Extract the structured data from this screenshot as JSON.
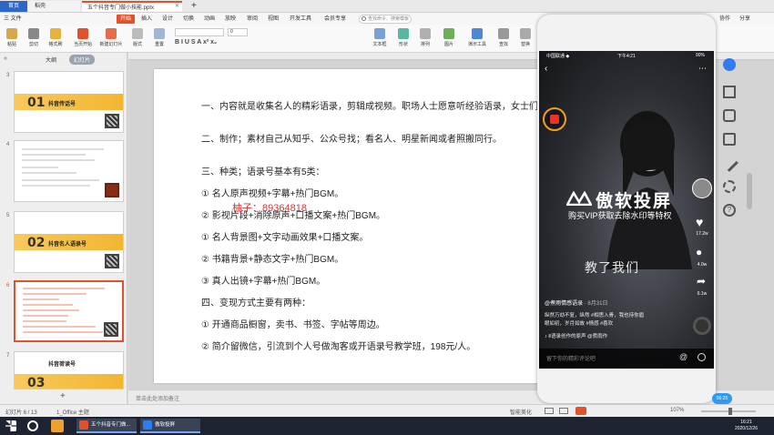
{
  "window": {
    "tabs": [
      {
        "label": "首页"
      },
      {
        "label": "稻壳"
      },
      {
        "label": "五个抖音专门做小技能.pptx"
      }
    ]
  },
  "menubar": {
    "items": [
      "三 文件",
      "开始",
      "插入",
      "设计",
      "切换",
      "动画",
      "放映",
      "审阅",
      "视图",
      "开发工具",
      "会员专享"
    ],
    "search_placeholder": "查找命令、搜索模板",
    "right": [
      "协作",
      "分享"
    ]
  },
  "ribbon": {
    "buttons": [
      "粘贴",
      "剪切",
      "格式刷",
      "当页开始",
      "新建幻灯片",
      "版式",
      "重置",
      "文本框",
      "形状",
      "排列",
      "图片",
      "演示工具",
      "查找",
      "替换"
    ],
    "format_glyphs": "B I U S A x² x₂",
    "font_name": "",
    "font_size": "0"
  },
  "leftpane": {
    "tab_outline": "大纲",
    "tab_slides": "幻灯片",
    "thumbs": [
      {
        "num": "3",
        "bignum": "01",
        "title": "抖音传话号",
        "style": "cover",
        "selected": false
      },
      {
        "num": "4",
        "bignum": "",
        "title": "",
        "style": "text",
        "selected": false
      },
      {
        "num": "5",
        "bignum": "02",
        "title": "抖音名人语录号",
        "style": "cover",
        "selected": false
      },
      {
        "num": "6",
        "bignum": "",
        "title": "",
        "style": "text-red",
        "selected": true
      },
      {
        "num": "7",
        "bignum": "03",
        "title": "抖音荷读号",
        "style": "cover",
        "selected": false
      }
    ]
  },
  "slide": {
    "lines": [
      "一、内容就是收集名人的精彩语录，剪辑成视频。职场人士愿意听经验语录，女士们",
      "二、制作；素材自己从知乎、公众号找；看名人、明星新闻或者照搬同行。",
      "三、种类；语录号基本有5类：",
      "① 名人原声视频+字幕+热门BGM。",
      "② 影视片段+消除原声+口播文案+热门BGM。",
      "① 名人背景图+文字动画效果+口播文案。",
      "② 书籍背景+静态文字+热门BGM。",
      "③ 真人出镜+字幕+热门BGM。",
      "四、变现方式主要有两种：",
      "① 开通商品橱窗，卖书、书签、字帖等周边。",
      "② 简介留微信，引流到个人号做淘客或开语录号教学班，198元/人。"
    ],
    "watermark": "柚子：89364818",
    "notes_placeholder": "单击此处添加备注"
  },
  "phone": {
    "carrier": "中国联通 ◆",
    "time": "下午4:21",
    "battery": "90%",
    "brand": "傲软投屏",
    "brand_sub": "购买VIP获取去除水印等特权",
    "caption": "教了我们",
    "likes": "17.2w",
    "comments": "4.0w",
    "shares": "6.1w",
    "author": "@煮雨情感语录",
    "date": "· 8月31日",
    "desc1": "纵然万劫不复，纵然 #相思入骨，我也待你眉",
    "desc2": "眼如初，岁月如故 #情感 #喜欢",
    "music": "♪ Ⅱ语录创作的原声  @煮雨作",
    "comment_placeholder": "留下你的精彩评论吧",
    "timer": "06:25"
  },
  "statusbar": {
    "slide_pos": "幻灯片 6 / 13",
    "theme": "1_Office 主题",
    "beautify": "智能美化",
    "zoom": "107%"
  },
  "taskbar": {
    "apps": [
      {
        "label": "五个抖音专门做..."
      },
      {
        "label": "傲软投屏"
      }
    ],
    "clock_time": "16:21",
    "clock_date": "2020/12/26"
  },
  "colors": {
    "accent": "#e0522c",
    "wps_blue": "#2e66c8",
    "thumb_yellow": "#f4ba3a"
  }
}
